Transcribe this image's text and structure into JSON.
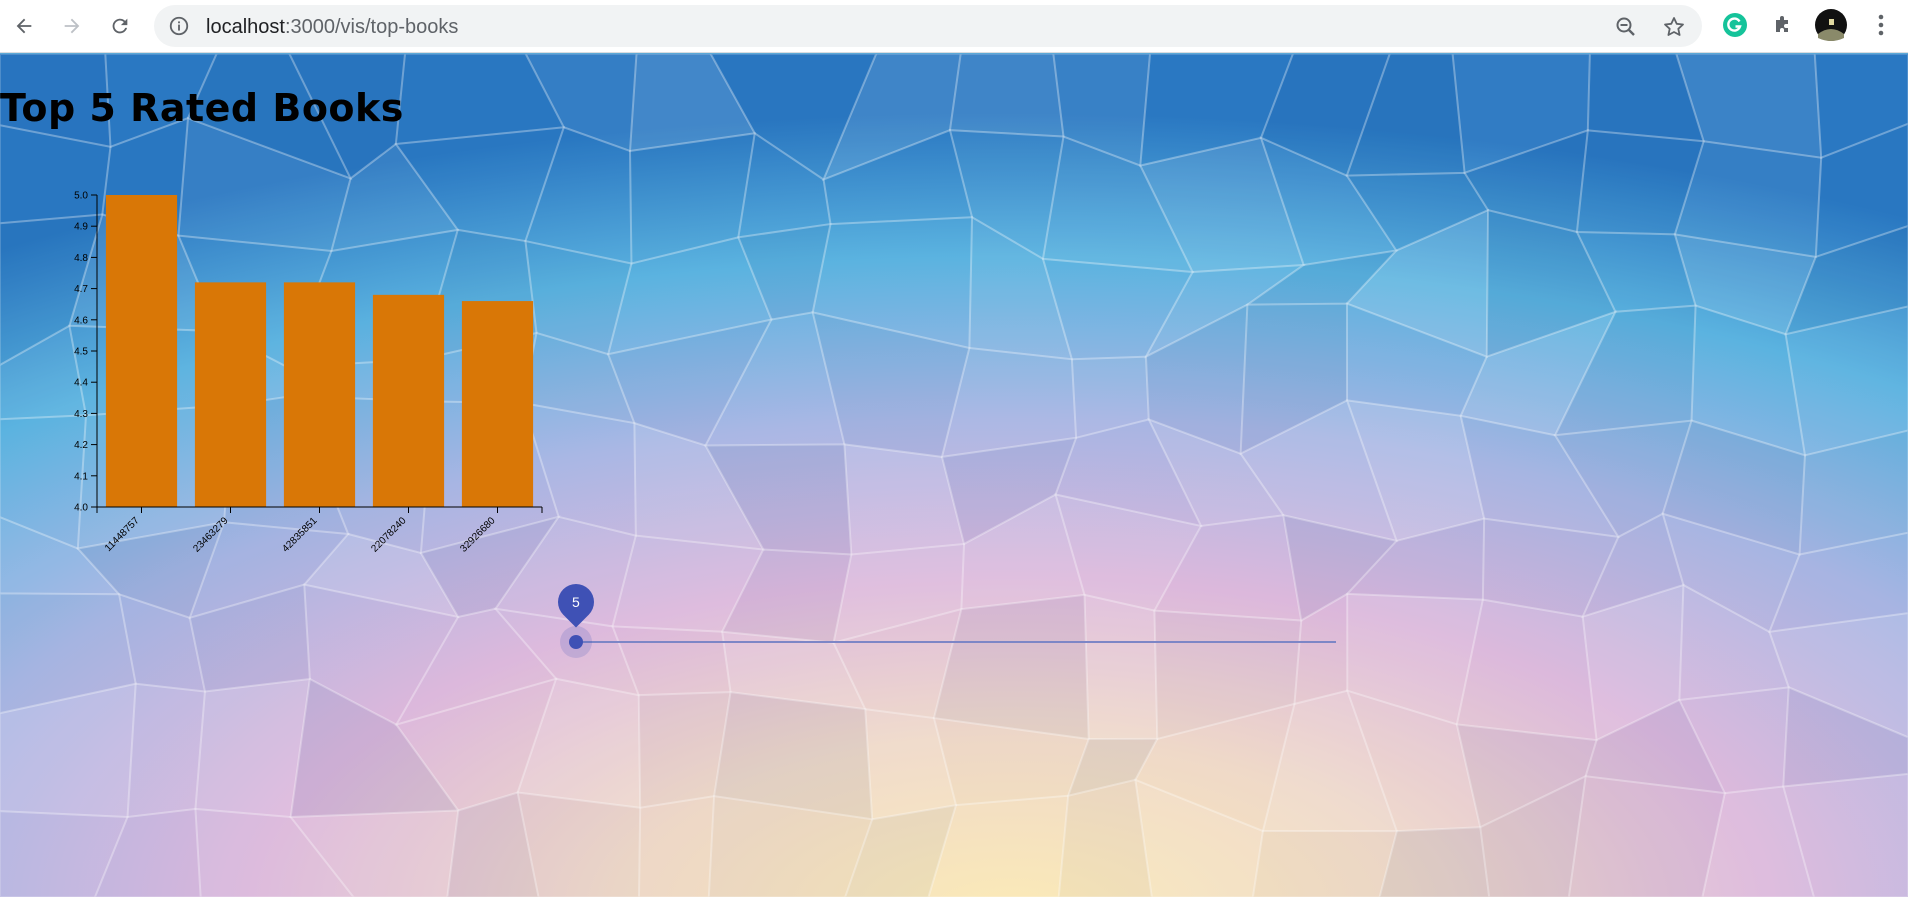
{
  "browser": {
    "url_host": "localhost",
    "url_path": ":3000/vis/top-books",
    "back_icon": "arrow-left-icon",
    "forward_icon": "arrow-right-icon",
    "reload_icon": "reload-icon"
  },
  "page": {
    "title": "Top 5 Rated Books"
  },
  "slider": {
    "value_label": "5",
    "value": 5,
    "color": "#3f51b5"
  },
  "colors": {
    "bar": "#d97706",
    "accent": "#3f51b5"
  },
  "chart_data": {
    "type": "bar",
    "title": "",
    "xlabel": "",
    "ylabel": "",
    "categories": [
      "11448757",
      "23463279",
      "42835851",
      "22078240",
      "32926680"
    ],
    "values": [
      5.0,
      4.72,
      4.72,
      4.68,
      4.66
    ],
    "ylim": [
      4.0,
      5.0
    ],
    "yticks": [
      "4.0",
      "4.1",
      "4.2",
      "4.3",
      "4.4",
      "4.5",
      "4.6",
      "4.7",
      "4.8",
      "4.9",
      "5.0"
    ],
    "grid": false,
    "bar_color": "#d97706"
  }
}
